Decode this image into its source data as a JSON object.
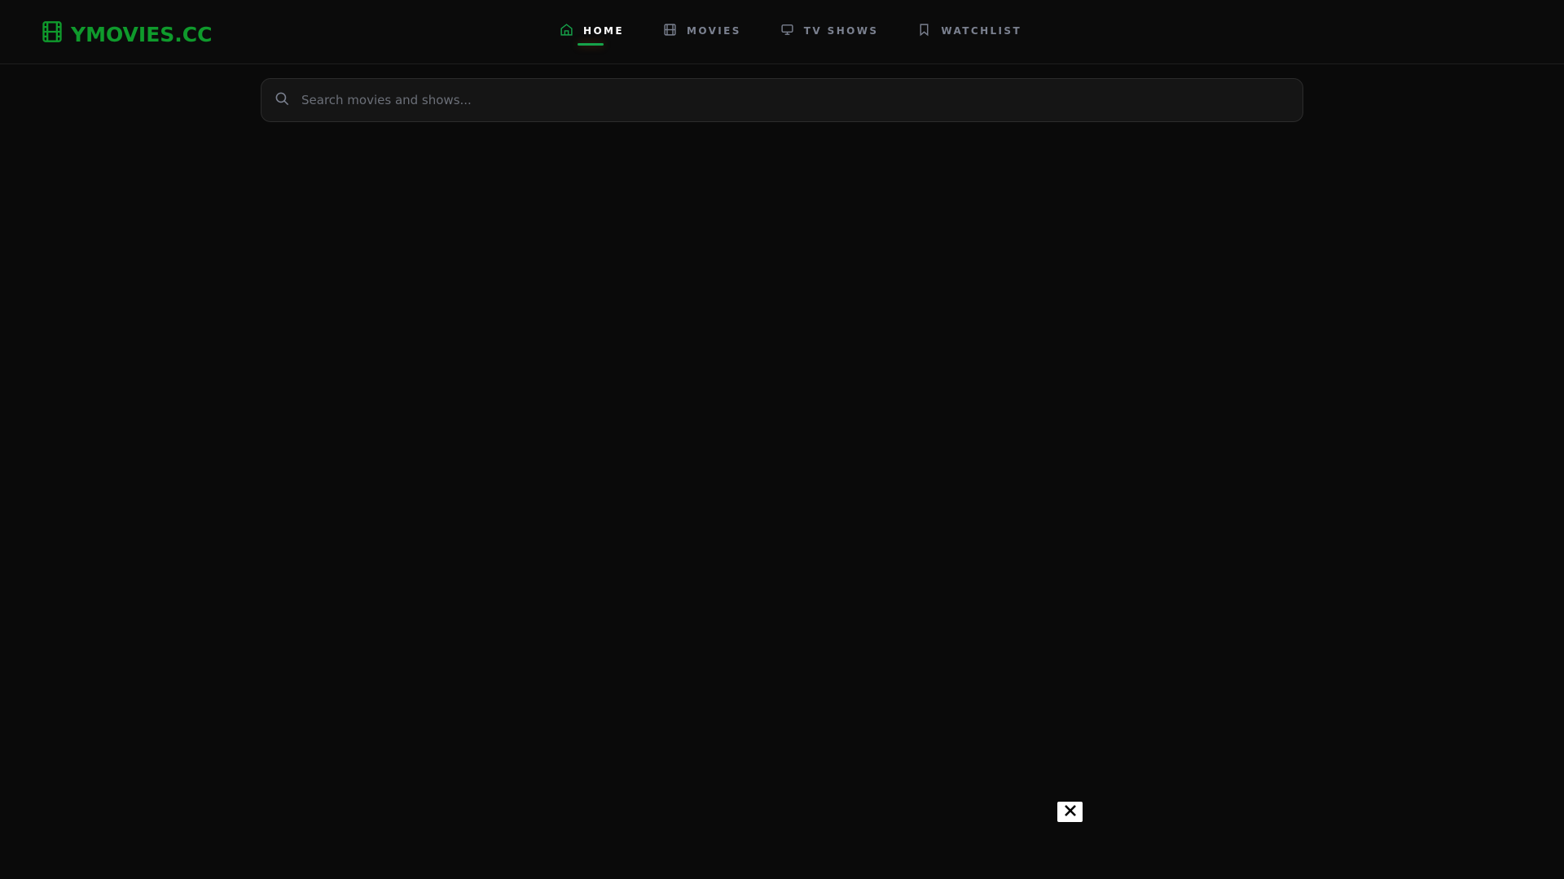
{
  "brand": {
    "name": "YMOVIES.CC",
    "color": "#0f9a2c"
  },
  "nav": [
    {
      "label": "HOME",
      "icon": "home-icon",
      "active": true
    },
    {
      "label": "MOVIES",
      "icon": "film-icon",
      "active": false
    },
    {
      "label": "TV SHOWS",
      "icon": "tv-icon",
      "active": false
    },
    {
      "label": "WATCHLIST",
      "icon": "bookmark-icon",
      "active": false
    }
  ],
  "search": {
    "placeholder": "Search movies and shows...",
    "value": ""
  },
  "overlay": {
    "close_icon": "close-icon"
  }
}
